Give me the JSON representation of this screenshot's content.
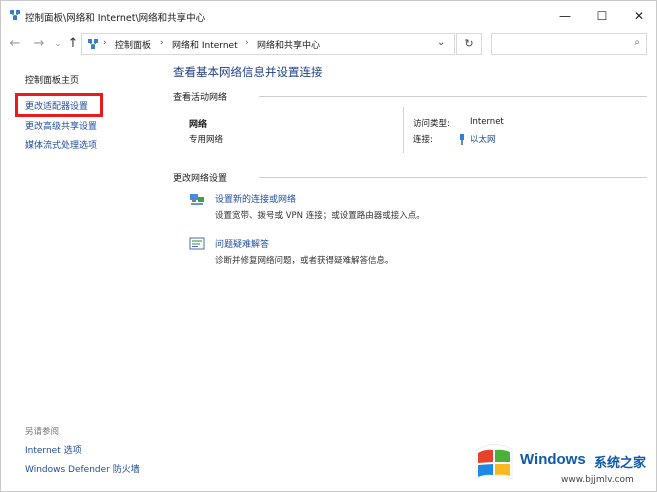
{
  "window": {
    "title": "控制面板\\网络和 Internet\\网络和共享中心",
    "minimize": "—",
    "maximize": "☐",
    "close": "✕"
  },
  "nav": {
    "back": "←",
    "forward": "→",
    "recent": "⌄",
    "up": "↑",
    "breadcrumbs": [
      "控制面板",
      "网络和 Internet",
      "网络和共享中心"
    ],
    "separator": "›",
    "dropdown": "⌄",
    "refresh": "↻",
    "search_placeholder": "",
    "search_icon": "⌕"
  },
  "sidebar": {
    "home": "控制面板主页",
    "items": [
      {
        "label": "更改适配器设置"
      },
      {
        "label": "更改高级共享设置"
      },
      {
        "label": "媒体流式处理选项"
      }
    ],
    "see_also_label": "另请参阅",
    "see_also": [
      {
        "label": "Internet 选项"
      },
      {
        "label": "Windows Defender 防火墙"
      }
    ],
    "highlight_color": "#e81c1c"
  },
  "main": {
    "title": "查看基本网络信息并设置连接",
    "active_networks_label": "查看活动网络",
    "network": {
      "name": "网络",
      "type": "专用网络",
      "access_type_label": "访问类型:",
      "access_type_value": "Internet",
      "connections_label": "连接:",
      "connections_value": "以太网"
    },
    "change_settings_label": "更改网络设置",
    "tasks": [
      {
        "link": "设置新的连接或网络",
        "desc": "设置宽带、拨号或 VPN 连接；或设置路由器或接入点。",
        "icon": "network-setup-icon"
      },
      {
        "link": "问题疑难解答",
        "desc": "诊断并修复网络问题，或者获得疑难解答信息。",
        "icon": "troubleshoot-icon"
      }
    ]
  },
  "watermark": {
    "brand": "Windows",
    "cn": "系统之家",
    "url": "www.bjjmlv.com"
  },
  "colors": {
    "link": "#1f4ea1",
    "title": "#1e3f87",
    "watermark": "#0e5aa8"
  }
}
